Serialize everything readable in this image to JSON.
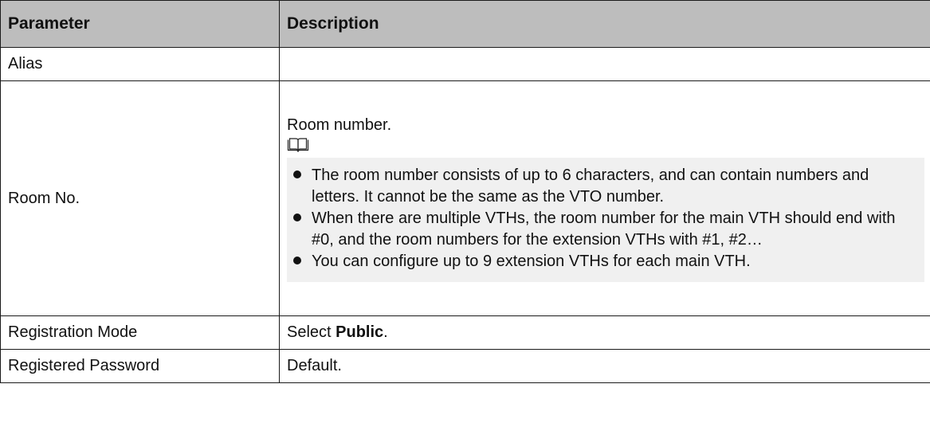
{
  "table": {
    "headers": {
      "parameter": "Parameter",
      "description": "Description"
    },
    "rows": {
      "alias": {
        "parameter": "Alias",
        "description": ""
      },
      "room_no": {
        "parameter": "Room No.",
        "description_intro": "Room number.",
        "note_icon": "book-note-icon",
        "notes": [
          "The room number consists of up to 6 characters, and can contain numbers and letters. It cannot be the same as the VTO number.",
          "When there are multiple VTHs, the room number for the main VTH should end with #0, and the room numbers for the extension VTHs with #1, #2…",
          "You can configure up to 9 extension VTHs for each main VTH."
        ]
      },
      "registration_mode": {
        "parameter": "Registration Mode",
        "description_prefix": "Select ",
        "description_bold": "Public",
        "description_suffix": "."
      },
      "registered_password": {
        "parameter": "Registered Password",
        "description": "Default."
      }
    }
  },
  "colors": {
    "header_bg": "#bdbdbd",
    "note_bg": "#f0f0f0",
    "border": "#1a1a1a"
  }
}
